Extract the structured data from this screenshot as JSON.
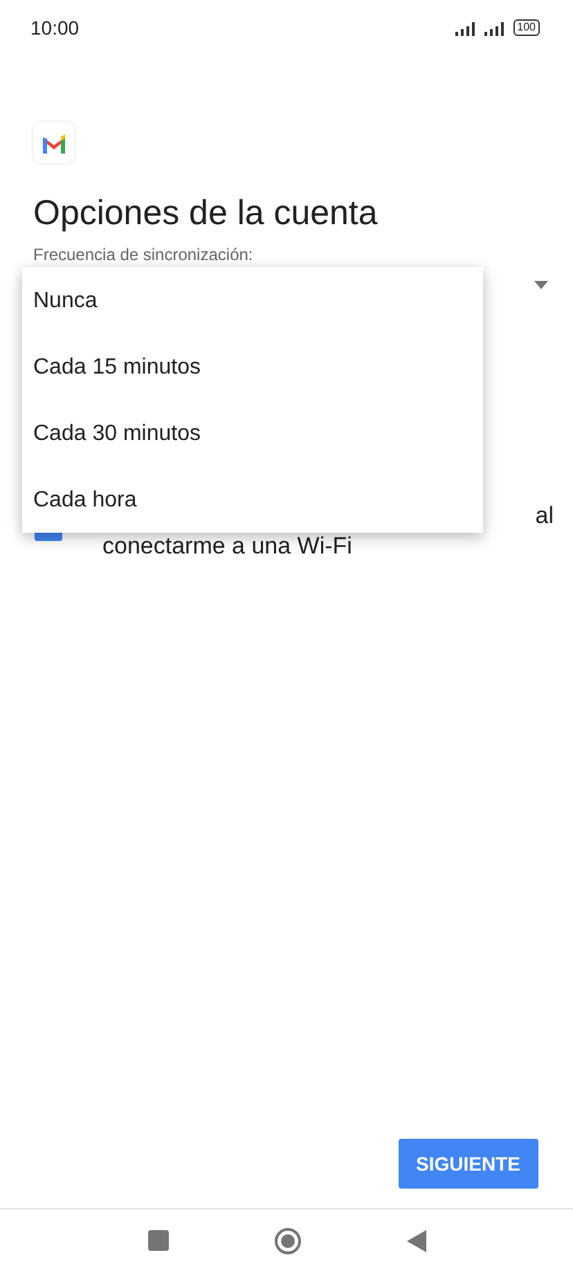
{
  "status_bar": {
    "time": "10:00",
    "battery": "100"
  },
  "title": "Opciones de la cuenta",
  "sync_frequency": {
    "label": "Frecuencia de sincronización:",
    "options": [
      {
        "label": "Nunca",
        "selected": false
      },
      {
        "label": "Cada 15 minutos",
        "selected": false
      },
      {
        "label": "Cada 30 minutos",
        "selected": false
      },
      {
        "label": "Cada hora",
        "selected": false
      }
    ]
  },
  "wifi_option": {
    "checked": true,
    "line_end": "al",
    "line_2": "conectarme a una Wi-Fi"
  },
  "next_button": "SIGUIENTE"
}
